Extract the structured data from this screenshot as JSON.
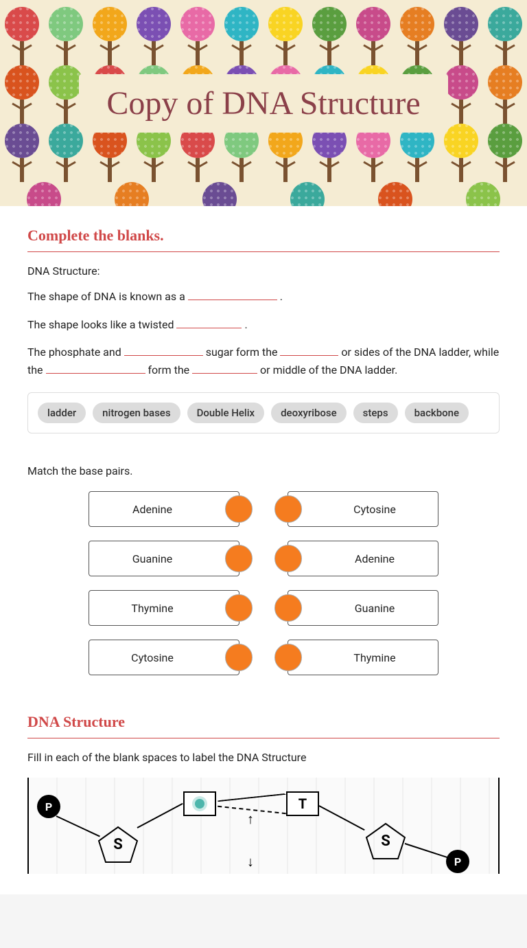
{
  "title": "Copy of DNA Structure",
  "section1": {
    "heading": "Complete the blanks.",
    "subtitle": "DNA Structure:",
    "line1_a": "The shape of DNA is known as a ",
    "line1_b": " .",
    "line2_a": "The shape looks like a twisted ",
    "line2_b": " .",
    "line3_a": "The phosphate and ",
    "line3_b": " sugar form the ",
    "line3_c": " or sides of the DNA ladder, while the ",
    "line3_d": " form the ",
    "line3_e": " or middle of the DNA ladder."
  },
  "word_bank": [
    "ladder",
    "nitrogen bases",
    "Double Helix",
    "deoxyribose",
    "steps",
    "backbone"
  ],
  "match": {
    "title": "Match the base pairs.",
    "left": [
      "Adenine",
      "Guanine",
      "Thymine",
      "Cytosine"
    ],
    "right": [
      "Cytosine",
      "Adenine",
      "Guanine",
      "Thymine"
    ]
  },
  "section2": {
    "heading": "DNA Structure",
    "instruction": "Fill in each of the blank spaces to label the DNA Structure",
    "labels": {
      "p": "P",
      "s": "S",
      "t": "T"
    }
  },
  "tree_colors": [
    "#d94a4a",
    "#7fc97f",
    "#f2a71b",
    "#7b4fb3",
    "#e86aa6",
    "#2fb5c4",
    "#f9d423",
    "#5a9e3f",
    "#c84b8a",
    "#e67e22",
    "#6a4c93",
    "#3ba99c",
    "#d9531e",
    "#8bc34a"
  ]
}
